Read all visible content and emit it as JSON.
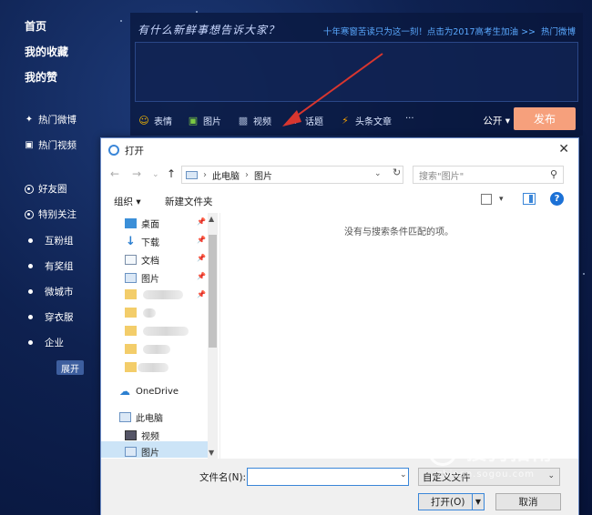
{
  "left_nav": {
    "main_items": [
      "首页",
      "我的收藏",
      "我的赞"
    ],
    "hot_items": [
      "热门微博",
      "热门视频"
    ],
    "group_items": [
      "好友圈",
      "特别关注"
    ],
    "dot_items": [
      "互粉组",
      "有奖组",
      "微城市",
      "穿衣服",
      "企业"
    ],
    "expand_label": "展开"
  },
  "composer": {
    "title": "有什么新鲜事想告诉大家？",
    "promo_link": "十年寒窗苦读只为这一刻！点击为2017高考生加油 >>",
    "hot_link": "热门微博",
    "tools": [
      "表情",
      "图片",
      "视频",
      "话题",
      "头条文章"
    ],
    "more": "···",
    "visibility": "公开",
    "publish": "发布"
  },
  "dialog": {
    "title": "打开",
    "close": "✕",
    "path": [
      "此电脑",
      "图片"
    ],
    "search_placeholder": "搜索\"图片\"",
    "organize": "组织 ▾",
    "new_folder": "新建文件夹",
    "tree": [
      "桌面",
      "下载",
      "文档",
      "图片"
    ],
    "onedrive": "OneDrive",
    "this_pc": "此电脑",
    "pc_items": [
      "视频",
      "图片"
    ],
    "empty_message": "没有与搜索条件匹配的项。",
    "filename_label": "文件名(N):",
    "filename_value": "",
    "filetype": "自定义文件",
    "open": "打开(O)",
    "cancel": "取消"
  },
  "watermark": {
    "logo": "S",
    "text": "搜狗指南",
    "url": "zhinan.sogou.com"
  },
  "colors": {
    "publish_button": "#f6a07c",
    "link": "#5aa9ff",
    "arrow": "#d8362f"
  }
}
